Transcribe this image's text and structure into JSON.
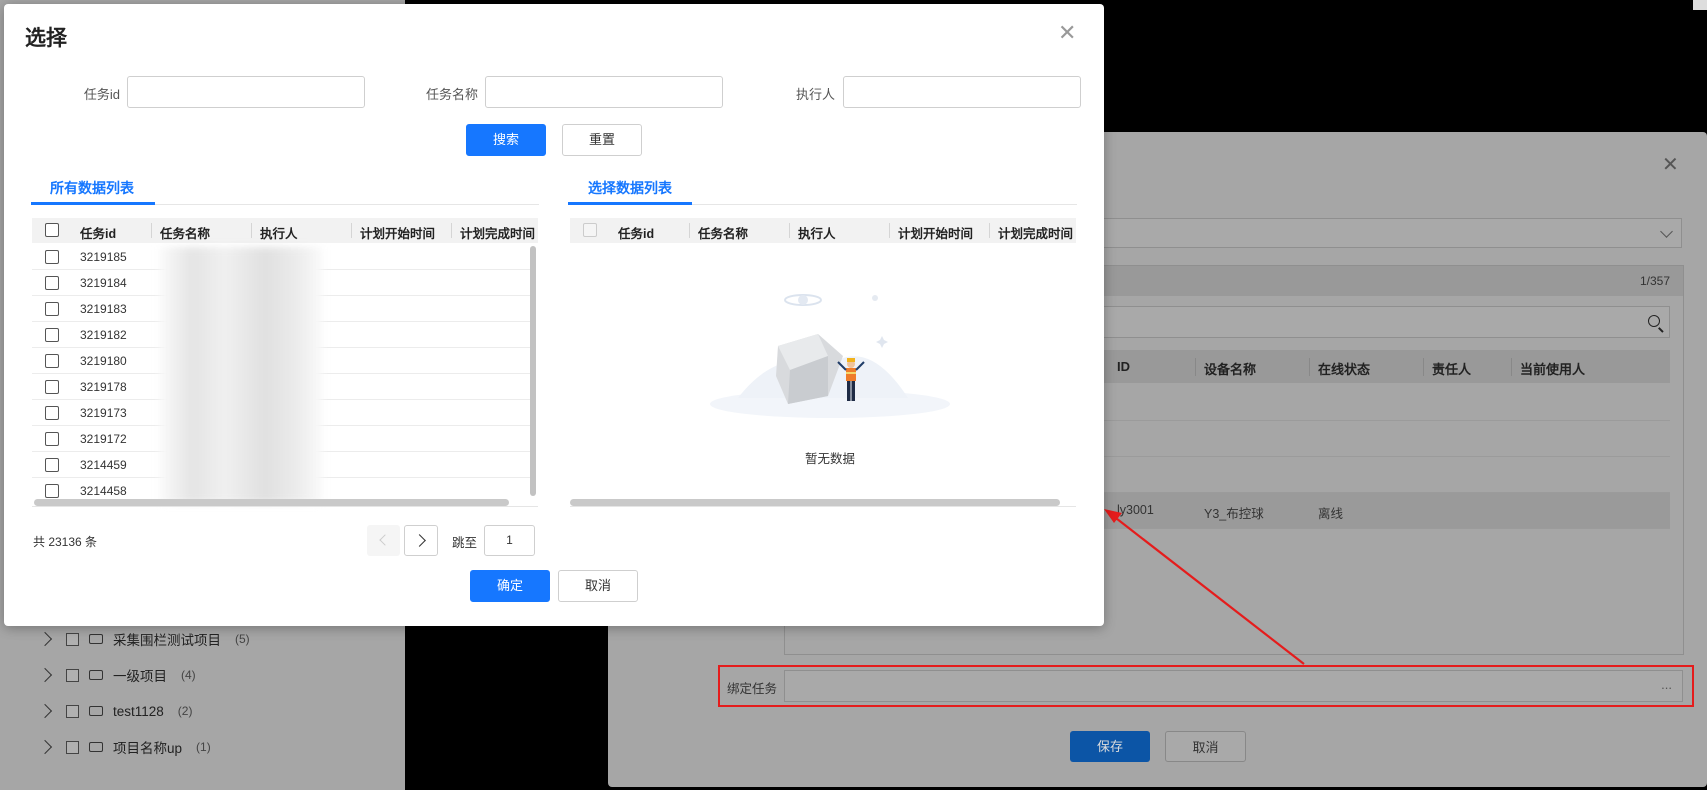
{
  "background_tree": {
    "items": [
      {
        "label": "采集围栏测试项目",
        "count": "(5)"
      },
      {
        "label": "一级项目",
        "count": "(4)"
      },
      {
        "label": "test1128",
        "count": "(2)"
      },
      {
        "label": "项目名称up",
        "count": "(1)"
      }
    ]
  },
  "background_dialog": {
    "pager": "1/357",
    "columns": [
      "ID",
      "设备名称",
      "在线状态",
      "责任人",
      "当前使用人"
    ],
    "row": {
      "id": "ly3001",
      "name": "Y3_布控球",
      "status": "离线"
    },
    "bind_label": "绑定任务",
    "bind_suffix": "...",
    "save_label": "保存",
    "cancel_label": "取消"
  },
  "modal": {
    "title": "选择",
    "filters": {
      "task_id_label": "任务id",
      "task_name_label": "任务名称",
      "executor_label": "执行人",
      "task_id_value": "",
      "task_name_value": "",
      "executor_value": ""
    },
    "search_label": "搜索",
    "reset_label": "重置",
    "left_tab": "所有数据列表",
    "right_tab": "选择数据列表",
    "columns": [
      "任务id",
      "任务名称",
      "执行人",
      "计划开始时间",
      "计划完成时间"
    ],
    "rows": [
      "3219185",
      "3219184",
      "3219183",
      "3219182",
      "3219180",
      "3219178",
      "3219173",
      "3219172",
      "3214459",
      "3214458"
    ],
    "empty_text": "暂无数据",
    "total": "共 23136 条",
    "jump_label": "跳至",
    "jump_value": "1",
    "confirm_label": "确定",
    "cancel_label": "取消"
  },
  "colors": {
    "primary": "#1677ff",
    "annotation": "#e51c1c",
    "overlay": "#a6a6a6"
  }
}
